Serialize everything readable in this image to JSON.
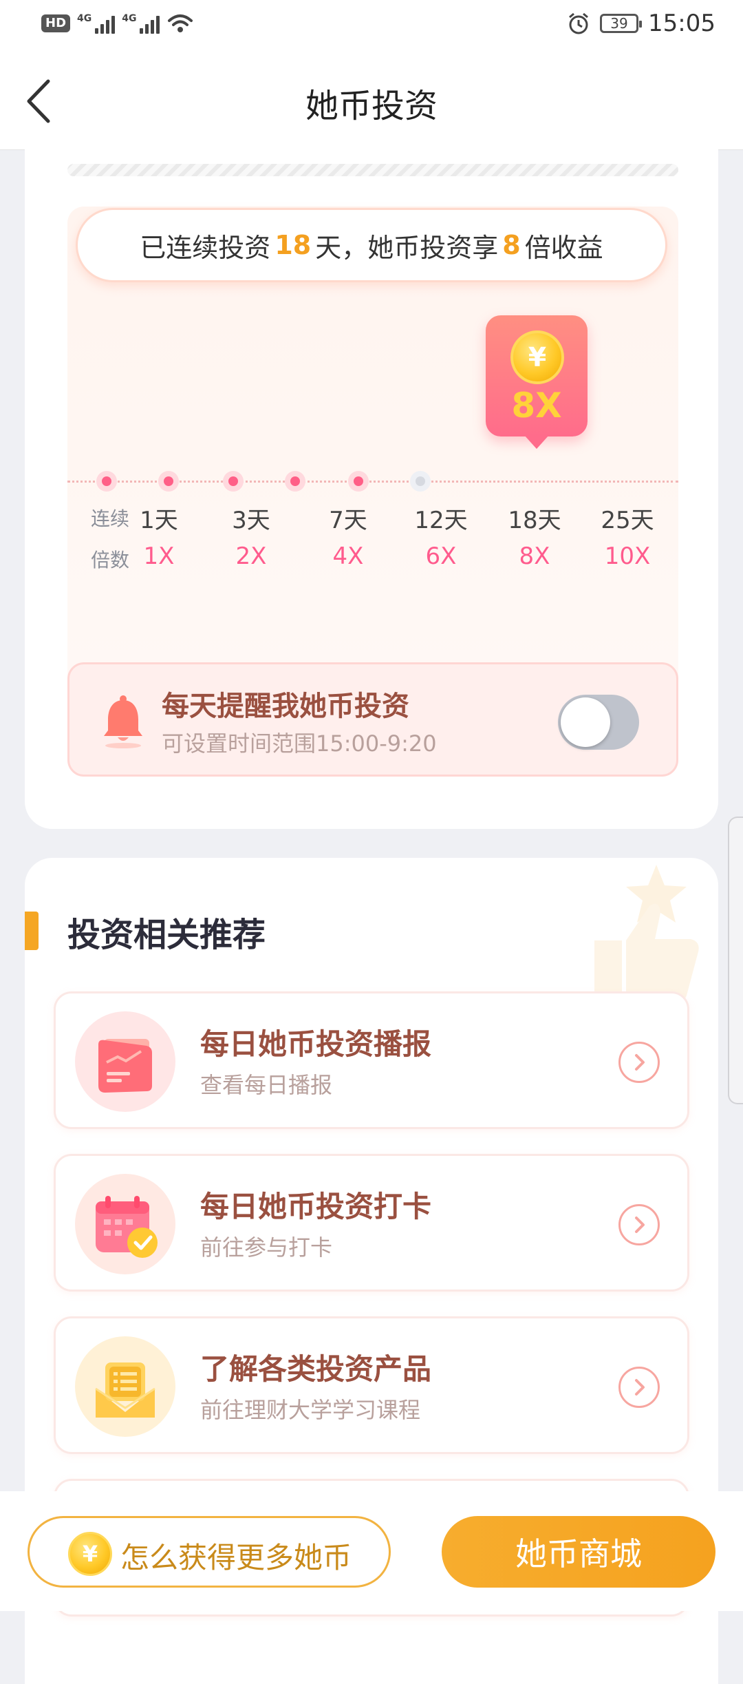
{
  "status_bar": {
    "hd_label": "HD",
    "net1": "4G",
    "net2": "4G",
    "battery_level": "39",
    "time": "15:05"
  },
  "header": {
    "title": "她币投资"
  },
  "streak": {
    "prefix": "已连续投资",
    "days": "18",
    "middle": "天，她币投资享",
    "multiplier": "8",
    "suffix": "倍收益"
  },
  "badge": {
    "coin_symbol": "¥",
    "value": "8X"
  },
  "timeline": {
    "row_label_days": "连续",
    "row_label_mult": "倍数",
    "steps": [
      {
        "day": "1天",
        "mult": "1X",
        "active": true
      },
      {
        "day": "3天",
        "mult": "2X",
        "active": true
      },
      {
        "day": "7天",
        "mult": "4X",
        "active": true
      },
      {
        "day": "12天",
        "mult": "6X",
        "active": true
      },
      {
        "day": "18天",
        "mult": "8X",
        "active": true
      },
      {
        "day": "25天",
        "mult": "10X",
        "active": false
      }
    ]
  },
  "reminder": {
    "title": "每天提醒我她币投资",
    "subtitle": "可设置时间范围15:00-9:20",
    "enabled": false
  },
  "recommend": {
    "title": "投资相关推荐",
    "items": [
      {
        "title": "每日她币投资播报",
        "subtitle": "查看每日播报",
        "icon": "report-card-icon"
      },
      {
        "title": "每日她币投资打卡",
        "subtitle": "前往参与打卡",
        "icon": "calendar-check-icon"
      },
      {
        "title": "了解各类投资产品",
        "subtitle": "前往理财大学学习课程",
        "icon": "product-list-icon"
      }
    ]
  },
  "bottom": {
    "earn_coin_symbol": "¥",
    "earn_label": "怎么获得更多她币",
    "mall_label": "她币商城"
  },
  "colors": {
    "accent_orange": "#f5a623",
    "pink": "#ff5b8d",
    "brown_text": "#9a5040"
  }
}
